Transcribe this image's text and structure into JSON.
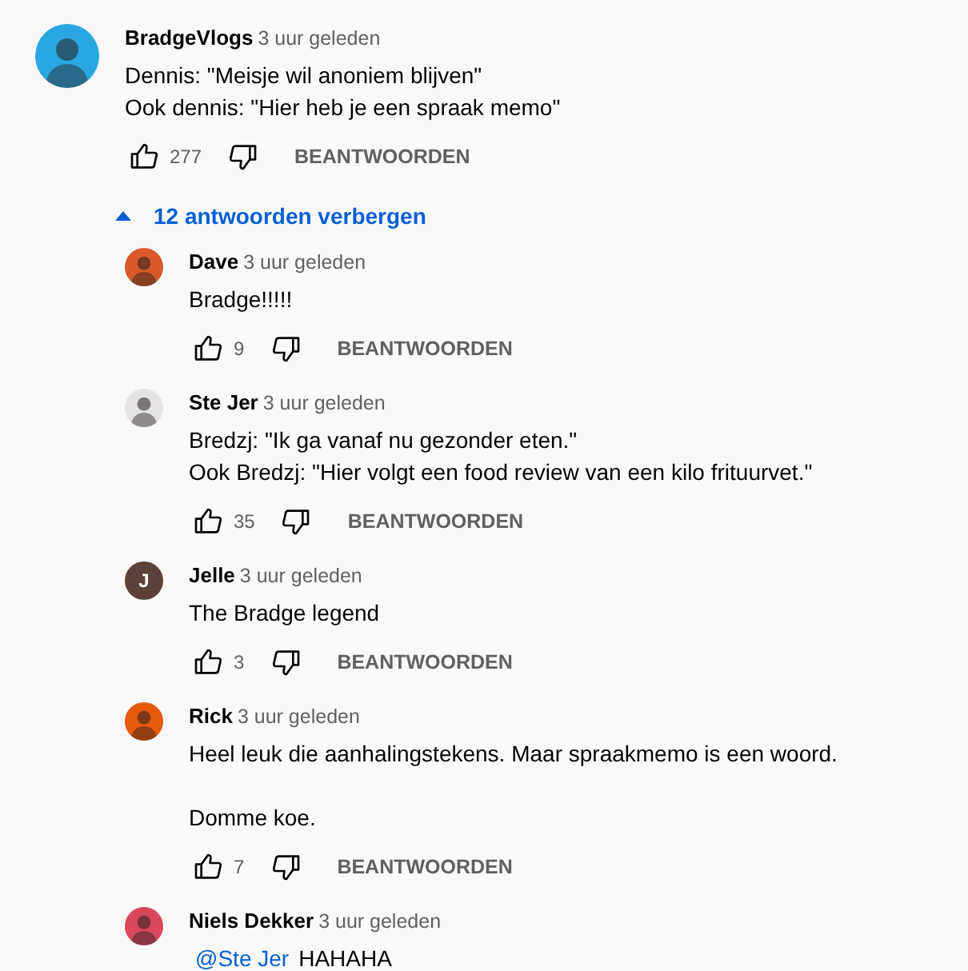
{
  "comment": {
    "author": "BradgeVlogs",
    "time": "3 uur geleden",
    "avatar": {
      "kind": "picture",
      "color": "#2aa7e0"
    },
    "lines": [
      "Dennis: \"Meisje wil anoniem blijven\"",
      "Ook dennis: \"Hier heb je een spraak memo\""
    ],
    "likes": "277",
    "reply_label": "BEANTWOORDEN"
  },
  "replies_toggle": {
    "label": "12 antwoorden verbergen",
    "expanded": true
  },
  "replies": [
    {
      "author": "Dave",
      "time": "3 uur geleden",
      "avatar": {
        "kind": "picture",
        "color": "#d9592a"
      },
      "lines": [
        "Bradge!!!!!"
      ],
      "likes": "9",
      "reply_label": "BEANTWOORDEN"
    },
    {
      "author": "Ste Jer",
      "time": "3 uur geleden",
      "avatar": {
        "kind": "picture",
        "color": "#e4e4e4"
      },
      "lines": [
        "Bredzj: \"Ik ga vanaf nu gezonder eten.\"",
        "Ook Bredzj: \"Hier volgt een food review van een kilo frituurvet.\""
      ],
      "likes": "35",
      "reply_label": "BEANTWOORDEN"
    },
    {
      "author": "Jelle",
      "time": "3 uur geleden",
      "avatar": {
        "kind": "letter",
        "letter": "J",
        "color": "#5d4037"
      },
      "lines": [
        "The Bradge legend"
      ],
      "likes": "3",
      "reply_label": "BEANTWOORDEN"
    },
    {
      "author": "Rick",
      "time": "3 uur geleden",
      "avatar": {
        "kind": "picture",
        "color": "#e85a0c"
      },
      "paragraphs": [
        [
          "Heel leuk die aanhalingstekens. Maar spraakmemo is een woord."
        ],
        [
          "Domme koe."
        ]
      ],
      "likes": "7",
      "reply_label": "BEANTWOORDEN"
    },
    {
      "author": "Niels Dekker",
      "time": "3 uur geleden",
      "avatar": {
        "kind": "picture",
        "color": "#d9475a"
      },
      "mention": "@Ste Jer",
      "lines": [
        "HAHAHA"
      ]
    }
  ]
}
